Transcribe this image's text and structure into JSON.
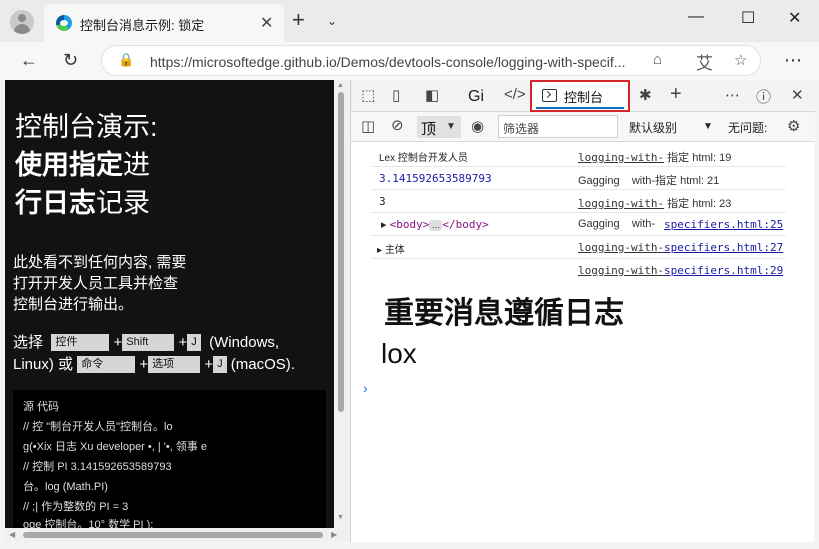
{
  "browser": {
    "tab_title": "控制台消息示例: 锁定",
    "tab_close": "✕",
    "new_tab": "+",
    "tab_menu": "⌄",
    "url": "https://microsoftedge.github.io/Demos/devtools-console/logging-with-specif...",
    "reader_glyph": "艾",
    "win_min": "—",
    "win_max": "☐",
    "win_close": "✕"
  },
  "page": {
    "heading_line1": "控制台演示:",
    "heading_line2_bold": "使用指定",
    "heading_line2_rest": "进",
    "heading_line3_bold": "行日志",
    "heading_line3_rest": "记录",
    "lead_line1": "此处看不到任何内容, 需要",
    "lead_line2": "打开开发人员工具并检查",
    "lead_line3": "控制台进行输出。",
    "keys": {
      "select": "选择",
      "ctrl": "控件",
      "shift": "Shift",
      "j": "J",
      "windows": "(Windows,",
      "linux": "Linux) 或",
      "cmd": "命令",
      "option": "选项",
      "j2": "J",
      "mac": "(macOS).",
      "plus": "+"
    },
    "code_lines": [
      "源        代码",
      "// 控      \"制台开发人员\"控制台。lo",
      "g(•Xix 日志            Xu developer •,        |       '•, 领事 e",
      "// 控制    PI 3.141592653589793",
      "台。log (Math.PI)",
      "//  ;|        作为整数的 PI = 3",
      "oge 控制台。10°                  数学 PI        );"
    ]
  },
  "devtools": {
    "tab_welcome": "Gi",
    "tab_console": "控制台",
    "context": "顶",
    "filter_placeholder": "筛选器",
    "levels": "默认级别",
    "issues": "无问题:",
    "messages": [
      {
        "text": "Lex 控制台开发人员",
        "source": "logging-with-",
        "source_rest": "指定 html: 19"
      },
      {
        "text": "3.141592653589793",
        "source": "Gagging",
        "source_rest": "with-指定 html: 21"
      },
      {
        "text": "3",
        "source": "logging-with-",
        "source_rest": "指定 html: 23"
      },
      {
        "text_open": "<body>",
        "text_dots": "…",
        "text_close": "</body>",
        "source": "Gagging",
        "source_mid": "with-",
        "source_link": "specifiers.html:25"
      },
      {
        "text": "主体",
        "source": "logging-with-",
        "source_link": "specifiers.html:27"
      },
      {
        "source": "logging-with-",
        "source_link": "specifiers.html:29"
      }
    ],
    "big_message": "重要消息遵循日志",
    "big_message2": "lox",
    "prompt": "›"
  }
}
